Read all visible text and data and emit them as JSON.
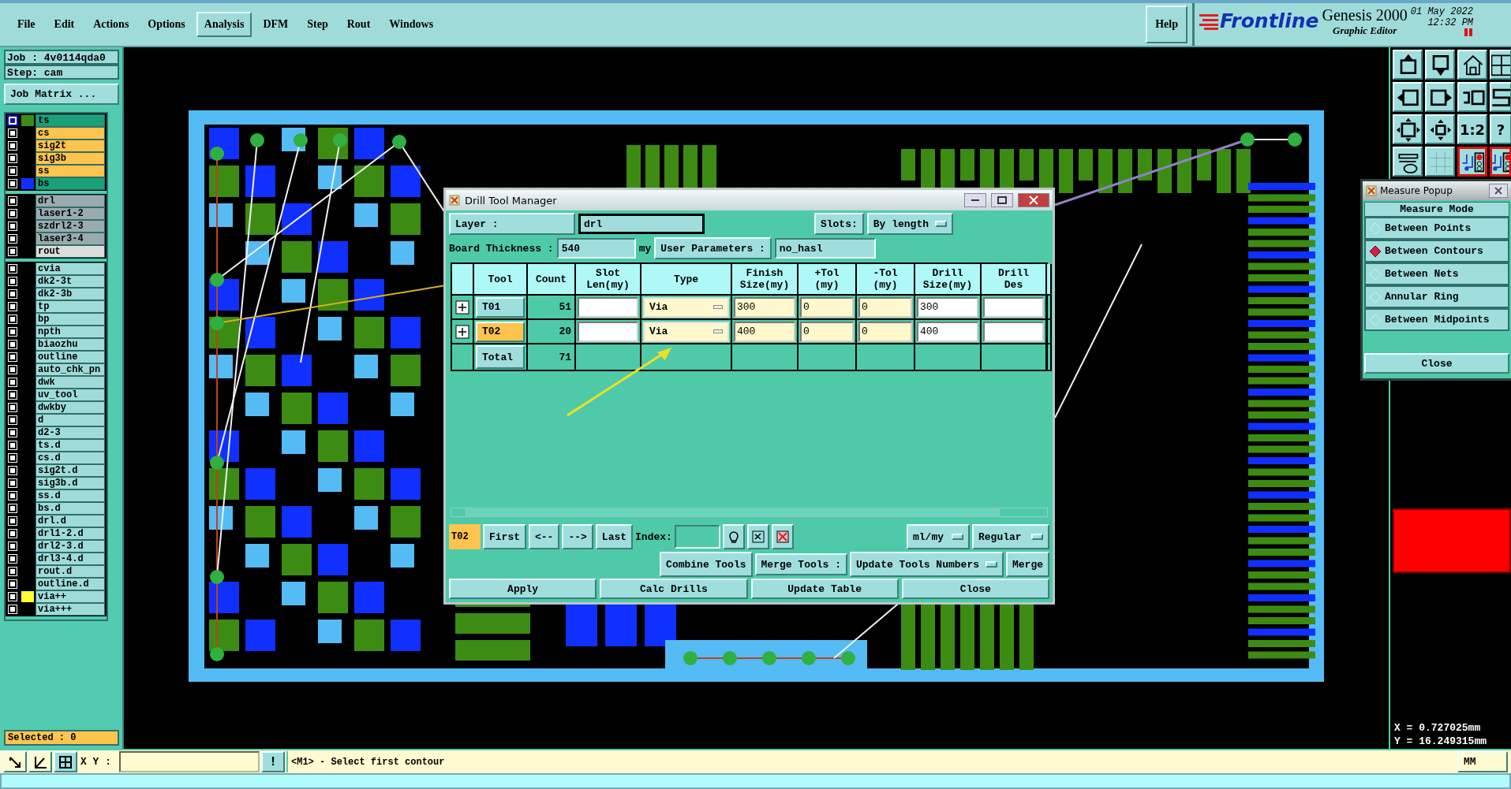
{
  "menu_bar": {
    "items": [
      {
        "label": "File",
        "selected": false
      },
      {
        "label": "Edit",
        "selected": false
      },
      {
        "label": "Actions",
        "selected": false
      },
      {
        "label": "Options",
        "selected": false
      },
      {
        "label": "Analysis",
        "selected": true
      },
      {
        "label": "DFM",
        "selected": false
      },
      {
        "label": "Step",
        "selected": false
      },
      {
        "label": "Rout",
        "selected": false
      },
      {
        "label": "Windows",
        "selected": false
      }
    ],
    "help": "Help"
  },
  "logo": {
    "brand": "Frontline",
    "product": "Genesis 2000",
    "subtitle": "Graphic Editor",
    "date": "01 May 2022",
    "time": "12:32 PM"
  },
  "job_panel": {
    "job": "Job : 4v0114qda0",
    "step": "Step: cam",
    "matrix_button": "Job Matrix ...",
    "layer_groups": [
      [
        {
          "name": "ts",
          "kind": "mask",
          "color": "#3c8c14",
          "selected": true
        },
        {
          "name": "cs",
          "kind": "signal",
          "selected": false
        },
        {
          "name": "sig2t",
          "kind": "signal",
          "selected": false
        },
        {
          "name": "sig3b",
          "kind": "signal",
          "selected": false
        },
        {
          "name": "ss",
          "kind": "signal",
          "selected": false
        },
        {
          "name": "bs",
          "kind": "mask",
          "color": "#1030ff",
          "selected": false
        }
      ],
      [
        {
          "name": "drl",
          "kind": "drill",
          "selected": false
        },
        {
          "name": "laser1-2",
          "kind": "drill",
          "selected": false
        },
        {
          "name": "szdrl2-3",
          "kind": "drill",
          "selected": false
        },
        {
          "name": "laser3-4",
          "kind": "drill",
          "selected": false
        },
        {
          "name": "rout",
          "kind": "rout",
          "selected": false
        }
      ],
      [
        {
          "name": "cvia",
          "kind": "misc",
          "selected": false
        },
        {
          "name": "dk2-3t",
          "kind": "misc",
          "selected": false
        },
        {
          "name": "dk2-3b",
          "kind": "misc",
          "selected": false
        },
        {
          "name": "tp",
          "kind": "misc",
          "selected": false
        },
        {
          "name": "bp",
          "kind": "misc",
          "selected": false
        },
        {
          "name": "npth",
          "kind": "misc",
          "selected": false
        },
        {
          "name": "biaozhu",
          "kind": "misc",
          "selected": false
        },
        {
          "name": "outline",
          "kind": "misc",
          "selected": false
        },
        {
          "name": "auto_chk_pn",
          "kind": "misc",
          "selected": false
        },
        {
          "name": "dwk",
          "kind": "misc",
          "selected": false
        },
        {
          "name": "uv_tool",
          "kind": "misc",
          "selected": false
        },
        {
          "name": "dwkby",
          "kind": "misc",
          "selected": false
        },
        {
          "name": "d",
          "kind": "misc",
          "selected": false
        },
        {
          "name": "d2-3",
          "kind": "misc",
          "selected": false
        },
        {
          "name": "ts.d",
          "kind": "misc",
          "selected": false
        },
        {
          "name": "cs.d",
          "kind": "misc",
          "selected": false
        },
        {
          "name": "sig2t.d",
          "kind": "misc",
          "selected": false
        },
        {
          "name": "sig3b.d",
          "kind": "misc",
          "selected": false
        },
        {
          "name": "ss.d",
          "kind": "misc",
          "selected": false
        },
        {
          "name": "bs.d",
          "kind": "misc",
          "selected": false
        },
        {
          "name": "drl.d",
          "kind": "misc",
          "selected": false
        },
        {
          "name": "drl1-2.d",
          "kind": "misc",
          "selected": false
        },
        {
          "name": "drl2-3.d",
          "kind": "misc",
          "selected": false
        },
        {
          "name": "drl3-4.d",
          "kind": "misc",
          "selected": false
        },
        {
          "name": "rout.d",
          "kind": "misc",
          "selected": false
        },
        {
          "name": "outline.d",
          "kind": "misc",
          "selected": false
        },
        {
          "name": "via++",
          "kind": "misc",
          "color": "#ffff30",
          "selected": false
        },
        {
          "name": "via+++",
          "kind": "misc",
          "selected": false
        }
      ]
    ],
    "selected_count": "Selected : 0"
  },
  "toolbar": {
    "buttons": [
      {
        "kind": "up",
        "selected": false
      },
      {
        "kind": "down",
        "selected": false
      },
      {
        "kind": "home",
        "selected": false
      },
      {
        "kind": "window",
        "selected": false
      },
      {
        "kind": "left",
        "selected": false
      },
      {
        "kind": "right",
        "selected": false
      },
      {
        "kind": "undo",
        "selected": false
      },
      {
        "kind": "curve",
        "selected": false
      },
      {
        "kind": "fit",
        "selected": false
      },
      {
        "kind": "center",
        "selected": false
      },
      {
        "kind": "text",
        "label": "1:2",
        "selected": false
      },
      {
        "kind": "text",
        "label": "?",
        "selected": false
      },
      {
        "kind": "tools",
        "selected": false
      },
      {
        "kind": "grid",
        "selected": false
      },
      {
        "kind": "circuit",
        "selected": true
      },
      {
        "kind": "circuit",
        "selected": true
      }
    ]
  },
  "drill_tool_manager": {
    "title": "Drill Tool Manager",
    "layer_label": "Layer :",
    "layer": "drl",
    "slots_label": "Slots:",
    "slots": "By length",
    "thickness_label": "Board Thickness :",
    "thickness": "540",
    "thickness_unit": "my",
    "user_params_button": "User Parameters :",
    "user_params": "no_hasl",
    "columns": [
      "Tool",
      "Count",
      "Slot Len(my)",
      "Type",
      "Finish Size(my)",
      "+Tol (my)",
      "-Tol (my)",
      "Drill Size(my)",
      "Drill Des"
    ],
    "rows": [
      {
        "tool": "T01",
        "selected": false,
        "count": "51",
        "type": "Via",
        "finish_size": "300",
        "plus_tol": "0",
        "minus_tol": "0",
        "drill_size": "300"
      },
      {
        "tool": "T02",
        "selected": true,
        "count": "20",
        "type": "Via",
        "finish_size": "400",
        "plus_tol": "0",
        "minus_tol": "0",
        "drill_size": "400"
      }
    ],
    "total": {
      "label": "Total",
      "count": "71"
    },
    "current_tool": "T02",
    "nav_buttons": [
      "First",
      "<--",
      "-->",
      "Last"
    ],
    "index_label": "Index:",
    "units": "ml/my",
    "mode": "Regular",
    "combine_button": "Combine Tools",
    "merge_label": "Merge Tools :",
    "merge_mode": "Update Tools Numbers",
    "merge_button": "Merge",
    "actions": [
      "Apply",
      "Calc Drills",
      "Update Table",
      "Close"
    ]
  },
  "measure_popup": {
    "title": "Measure Popup",
    "header": "Measure Mode",
    "options": [
      {
        "label": "Between Points",
        "selected": false
      },
      {
        "label": "Between Contours",
        "selected": true
      },
      {
        "label": "Between Nets",
        "selected": false
      },
      {
        "label": "Annular Ring",
        "selected": false
      },
      {
        "label": "Between Midpoints",
        "selected": false
      }
    ],
    "close_button": "Close"
  },
  "coordinates": {
    "x": "X = 0.727025mm",
    "y": "Y = 16.249315mm"
  },
  "status_bar": {
    "xy_label": "X Y :",
    "alert_button": "!",
    "message": "<M1> - Select first contour",
    "units": "MM"
  }
}
